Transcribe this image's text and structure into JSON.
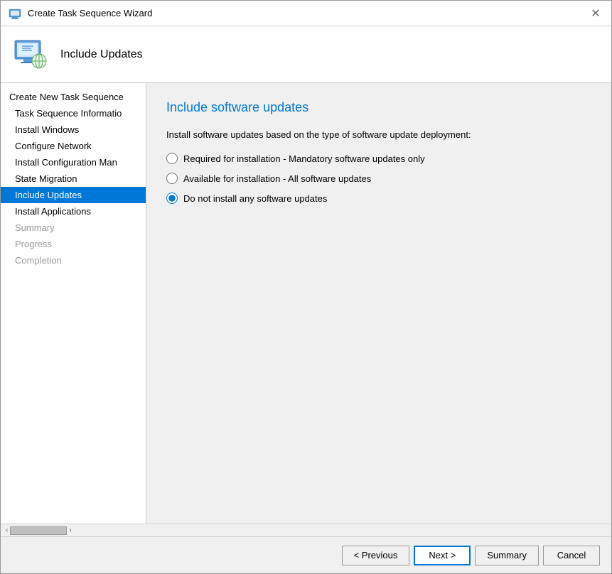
{
  "window": {
    "title": "Create Task Sequence Wizard",
    "close_label": "✕"
  },
  "header": {
    "icon_alt": "task-sequence-icon",
    "title": "Include Updates"
  },
  "sidebar": {
    "section_header": "Create New Task Sequence",
    "items": [
      {
        "id": "task-sequence-info",
        "label": "Task Sequence Informatio",
        "state": "normal"
      },
      {
        "id": "install-windows",
        "label": "Install Windows",
        "state": "normal"
      },
      {
        "id": "configure-network",
        "label": "Configure Network",
        "state": "normal"
      },
      {
        "id": "install-config-mgr",
        "label": "Install Configuration Man",
        "state": "normal"
      },
      {
        "id": "state-migration",
        "label": "State Migration",
        "state": "normal"
      },
      {
        "id": "include-updates",
        "label": "Include Updates",
        "state": "active"
      },
      {
        "id": "install-applications",
        "label": "Install Applications",
        "state": "normal"
      }
    ],
    "bottom_items": [
      {
        "id": "summary",
        "label": "Summary",
        "state": "disabled"
      },
      {
        "id": "progress",
        "label": "Progress",
        "state": "disabled"
      },
      {
        "id": "completion",
        "label": "Completion",
        "state": "disabled"
      }
    ]
  },
  "main": {
    "title": "Include software updates",
    "description": "Install software updates based on the type of software update deployment:",
    "options": [
      {
        "id": "required",
        "label": "Required for installation - Mandatory software updates only",
        "checked": false
      },
      {
        "id": "available",
        "label": "Available for installation - All software updates",
        "checked": false
      },
      {
        "id": "do-not-install",
        "label": "Do not install any software updates",
        "checked": true
      }
    ]
  },
  "buttons": {
    "previous": "< Previous",
    "next": "Next >",
    "summary": "Summary",
    "cancel": "Cancel"
  },
  "scrollbar": {
    "arrow_left": "‹",
    "arrow_right": "›"
  }
}
